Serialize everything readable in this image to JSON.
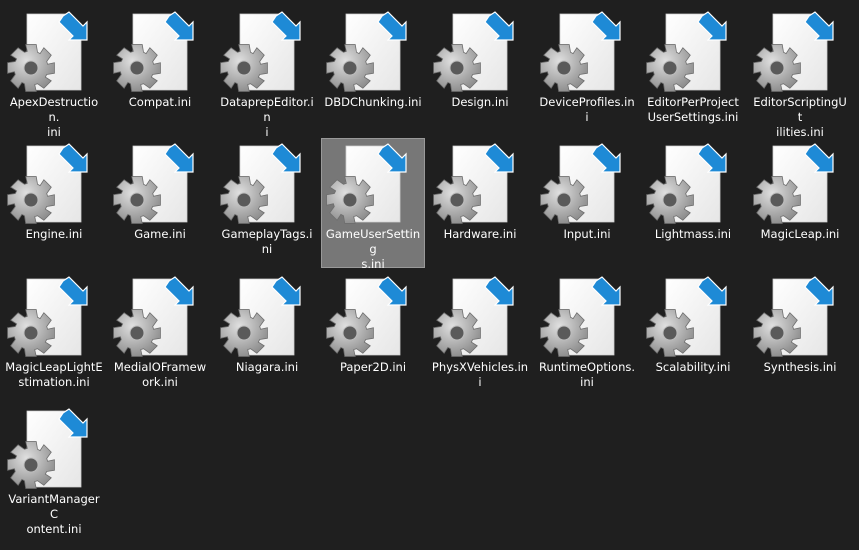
{
  "folder_view": {
    "icon": "ini-settings-file-icon",
    "overlay_icon": "shortcut-arrow-icon",
    "selected_index": 11,
    "colors": {
      "background": "#1f1f1f",
      "selection": "#777777",
      "text": "#ffffff",
      "shortcut_arrow": "#1e8ad6",
      "gear": "#9a9a9a"
    },
    "files": [
      {
        "label": "ApexDestruction.\nini"
      },
      {
        "label": "Compat.ini"
      },
      {
        "label": "DataprepEditor.in\ni"
      },
      {
        "label": "DBDChunking.ini"
      },
      {
        "label": "Design.ini"
      },
      {
        "label": "DeviceProfiles.ini"
      },
      {
        "label": "EditorPerProject\nUserSettings.ini"
      },
      {
        "label": "EditorScriptingUt\nilities.ini"
      },
      {
        "label": "Engine.ini"
      },
      {
        "label": "Game.ini"
      },
      {
        "label": "GameplayTags.ini"
      },
      {
        "label": "GameUserSetting\ns.ini"
      },
      {
        "label": "Hardware.ini"
      },
      {
        "label": "Input.ini"
      },
      {
        "label": "Lightmass.ini"
      },
      {
        "label": "MagicLeap.ini"
      },
      {
        "label": "MagicLeapLightE\nstimation.ini"
      },
      {
        "label": "MediaIOFramew\nork.ini"
      },
      {
        "label": "Niagara.ini"
      },
      {
        "label": "Paper2D.ini"
      },
      {
        "label": "PhysXVehicles.ini"
      },
      {
        "label": "RuntimeOptions.\nini"
      },
      {
        "label": "Scalability.ini"
      },
      {
        "label": "Synthesis.ini"
      },
      {
        "label": "VariantManagerC\nontent.ini"
      }
    ]
  }
}
